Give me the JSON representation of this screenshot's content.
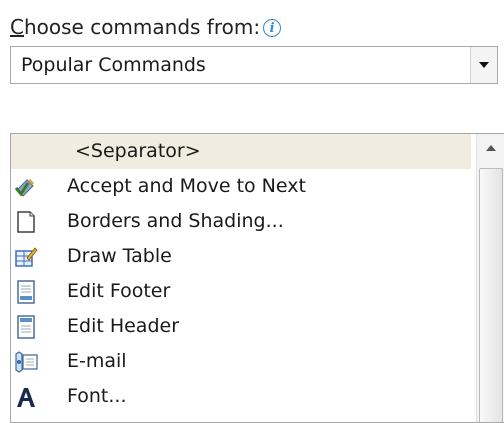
{
  "choose": {
    "label_mnemonic": "C",
    "label_rest": "hoose commands from:",
    "info_icon": "i"
  },
  "combo": {
    "value": "Popular Commands"
  },
  "list": {
    "items": [
      {
        "label": "<Separator>",
        "icon": "none",
        "selected": true
      },
      {
        "label": "Accept and Move to Next",
        "icon": "accept-change-icon"
      },
      {
        "label": "Borders and Shading...",
        "icon": "page-border-icon"
      },
      {
        "label": "Draw Table",
        "icon": "draw-table-icon"
      },
      {
        "label": "Edit Footer",
        "icon": "edit-footer-icon"
      },
      {
        "label": "Edit Header",
        "icon": "edit-header-icon"
      },
      {
        "label": "E-mail",
        "icon": "email-icon"
      },
      {
        "label": "Font...",
        "icon": "font-icon"
      }
    ]
  },
  "colors": {
    "selection": "#f0ecdf",
    "border": "#a9a9a9",
    "info_blue": "#3c86c9"
  }
}
